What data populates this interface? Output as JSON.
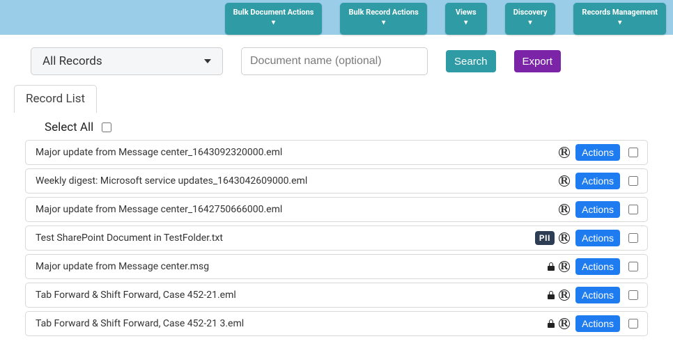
{
  "topnav": {
    "items": [
      {
        "label": "Bulk Document Actions"
      },
      {
        "label": "Bulk Record Actions"
      },
      {
        "label": "Views"
      },
      {
        "label": "Discovery"
      },
      {
        "label": "Records Management"
      }
    ]
  },
  "filter": {
    "dropdown_value": "All Records",
    "search_placeholder": "Document name (optional)",
    "search_label": "Search",
    "export_label": "Export"
  },
  "tab": {
    "label": "Record List"
  },
  "select_all": {
    "label": "Select All"
  },
  "actions_label": "Actions",
  "pii_label": "PII",
  "records": [
    {
      "name": "Major update from Message center_1643092320000.eml",
      "pii": false,
      "locked": false
    },
    {
      "name": "Weekly digest: Microsoft service updates_1643042609000.eml",
      "pii": false,
      "locked": false
    },
    {
      "name": "Major update from Message center_1642750666000.eml",
      "pii": false,
      "locked": false
    },
    {
      "name": "Test SharePoint Document in TestFolder.txt",
      "pii": true,
      "locked": false
    },
    {
      "name": "Major update from Message center.msg",
      "pii": false,
      "locked": true
    },
    {
      "name": "Tab Forward & Shift Forward, Case 452-21.eml",
      "pii": false,
      "locked": true
    },
    {
      "name": "Tab Forward & Shift Forward, Case 452-21 3.eml",
      "pii": false,
      "locked": true
    }
  ]
}
